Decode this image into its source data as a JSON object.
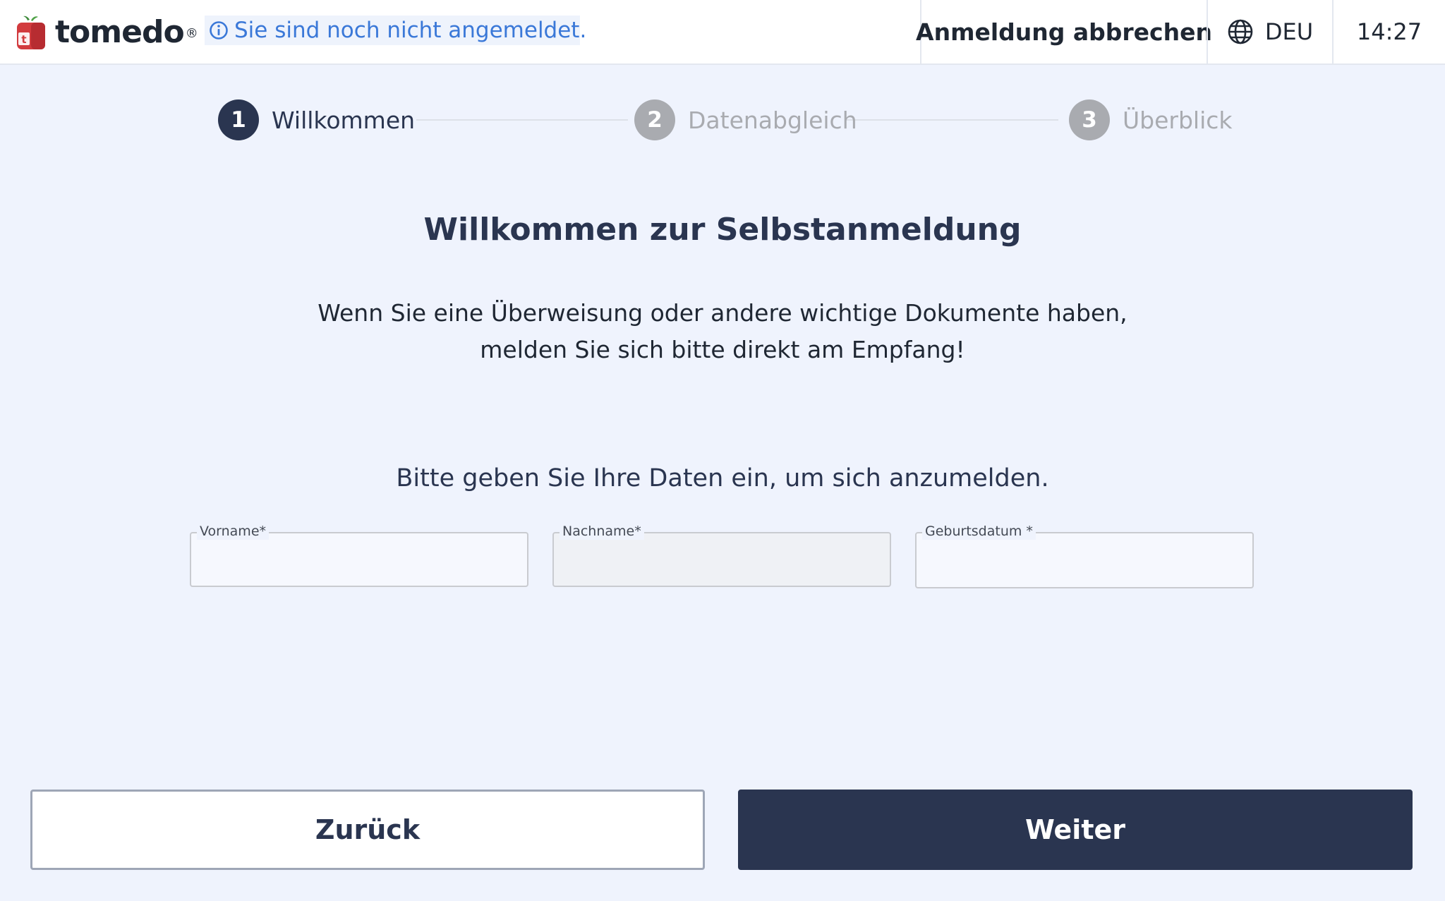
{
  "header": {
    "brand": {
      "name": "tomedo",
      "registered_mark": "®",
      "logo_letter": "t"
    },
    "login_status": "Sie sind noch nicht angemeldet.",
    "cancel_label": "Anmeldung abbrechen",
    "language": "DEU",
    "time": "14:27",
    "icons": {
      "info": "info-circle-icon",
      "language": "globe-icon",
      "logo": "tomedo-logo-icon"
    }
  },
  "stepper": {
    "steps": [
      {
        "number": "1",
        "label": "Willkommen",
        "state": "active"
      },
      {
        "number": "2",
        "label": "Datenabgleich",
        "state": "inactive"
      },
      {
        "number": "3",
        "label": "Überblick",
        "state": "inactive"
      }
    ]
  },
  "main": {
    "title": "Willkommen zur Selbstanmeldung",
    "notice_line1": "Wenn Sie eine Überweisung oder andere wichtige Dokumente haben,",
    "notice_line2": "melden Sie sich bitte direkt am Empfang!",
    "prompt": "Bitte geben Sie Ihre Daten ein, um sich anzumelden."
  },
  "form": {
    "fields": [
      {
        "label": "Vorname*",
        "value": "",
        "state": "enabled"
      },
      {
        "label": "Nachname*",
        "value": "",
        "state": "disabled"
      },
      {
        "label": "Geburtsdatum *",
        "value": "",
        "state": "enabled"
      }
    ]
  },
  "actions": {
    "back_label": "Zurück",
    "next_label": "Weiter"
  },
  "colors": {
    "primary_dark": "#2a3550",
    "page_background": "#eff3fd",
    "status_text": "#3a78d8",
    "brand_red": "#d23b3e",
    "inactive_step": "#a9abb0"
  }
}
